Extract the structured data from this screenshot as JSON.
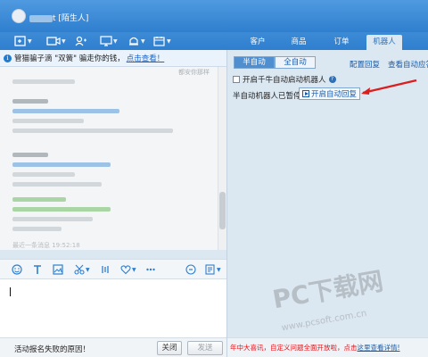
{
  "window": {
    "title_suffix": "t [陌生人]"
  },
  "notice": {
    "text": "管猫骗子滴 \"双簧\" 骗走你的钱，",
    "link": "点击查看！"
  },
  "chat": {
    "top_hint": "都安你那样",
    "last_line": "最近一条消息 19:52:18"
  },
  "bottom_left": {
    "text": "活动报名失败的原因！",
    "close": "关闭",
    "send": "发送"
  },
  "right_tabs": [
    "客户",
    "商品",
    "订单",
    "机器人"
  ],
  "robot": {
    "mode_semi": "半自动",
    "mode_full": "全自动",
    "config_reply": "配置回复",
    "view_auto": "查看自动应答",
    "checkbox_label": "开启千牛自动启动机器人",
    "status_text": "半自动机器人已暂停",
    "start_button": "开启自动回复"
  },
  "bottom_right": {
    "red": "年中大喜讯，自定义问题全面开放啦，",
    "suffix": "点击",
    "link": "这里查看详情!"
  },
  "watermark": {
    "line1": "PC下载网",
    "line2": "www.pcsoft.com.cn"
  },
  "colors": {
    "accent": "#2f7fcf",
    "link": "#1a64c8",
    "red": "#e0151b"
  }
}
